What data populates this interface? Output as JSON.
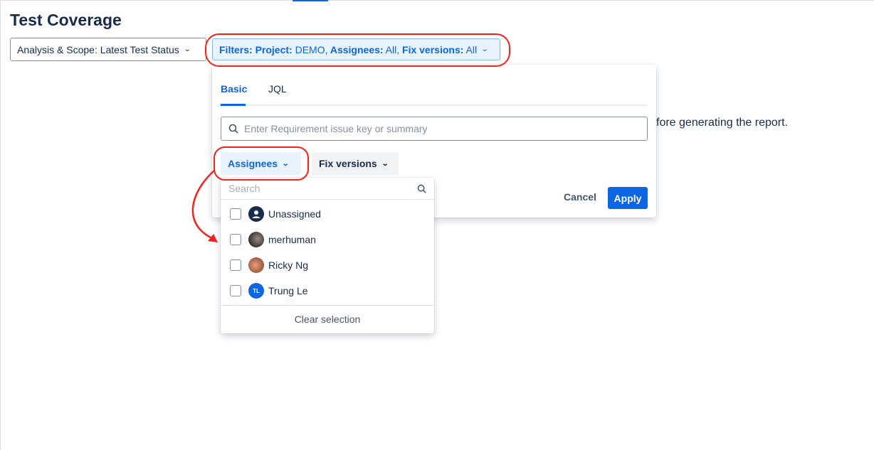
{
  "page": {
    "title": "Test Coverage",
    "background_text": "fore generating the report."
  },
  "toolbar": {
    "scope_label": "Analysis & Scope: Latest Test Status",
    "filters": {
      "prefix": "Filters:",
      "project_key": "Project:",
      "project_value": " DEMO,",
      "assignees_key": " Assignees:",
      "assignees_value": " All,",
      "fix_key": " Fix versions:",
      "fix_value": " All"
    }
  },
  "popup": {
    "tabs": [
      {
        "label": "Basic",
        "active": true
      },
      {
        "label": "JQL",
        "active": false
      }
    ],
    "search_placeholder": "Enter Requirement issue key or summary",
    "chips": {
      "assignees": "Assignees",
      "fix_versions": "Fix versions"
    },
    "cancel": "Cancel",
    "apply": "Apply"
  },
  "assignees_dropdown": {
    "search_placeholder": "Search",
    "items": [
      {
        "name": "Unassigned",
        "checked": false,
        "avatar": "user-icon"
      },
      {
        "name": "merhuman",
        "checked": false,
        "avatar": "photo"
      },
      {
        "name": "Ricky Ng",
        "checked": false,
        "avatar": "photo"
      },
      {
        "name": "Trung Le",
        "checked": false,
        "avatar": "TL"
      }
    ],
    "clear": "Clear selection"
  },
  "colors": {
    "primary": "#0c66e4",
    "annotation": "#f5221b",
    "text": "#172b4d"
  }
}
